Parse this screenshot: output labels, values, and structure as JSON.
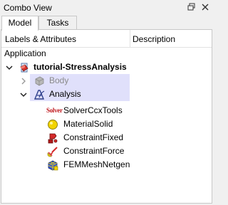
{
  "window": {
    "title": "Combo View"
  },
  "tabs": [
    {
      "label": "Model"
    },
    {
      "label": "Tasks"
    }
  ],
  "tree": {
    "headers": {
      "labels": "Labels & Attributes",
      "description": "Description"
    },
    "root_label": "Application",
    "document": {
      "label": "tutorial-StressAnalysis"
    },
    "items": [
      {
        "label": "Body",
        "icon": "body-icon"
      },
      {
        "label": "Analysis",
        "icon": "analysis-icon"
      },
      {
        "label": "SolverCcxTools",
        "icon": "solver-icon",
        "icon_text": "Solver"
      },
      {
        "label": "MaterialSolid",
        "icon": "material-icon"
      },
      {
        "label": "ConstraintFixed",
        "icon": "constraint-fixed-icon"
      },
      {
        "label": "ConstraintForce",
        "icon": "constraint-force-icon"
      },
      {
        "label": "FEMMeshNetgen",
        "icon": "fem-mesh-icon"
      }
    ]
  }
}
